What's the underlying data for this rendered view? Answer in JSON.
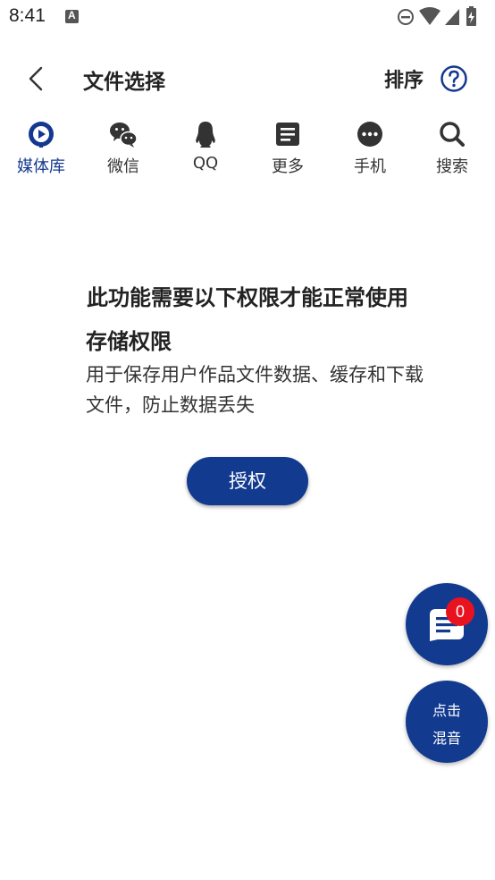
{
  "status": {
    "time": "8:41",
    "notification_icon": "a-icon"
  },
  "header": {
    "title": "文件选择",
    "sort_label": "排序",
    "help_icon": "help-circle-icon",
    "back_icon": "chevron-left-icon"
  },
  "tabs": [
    {
      "label": "媒体库",
      "icon": "media-library-icon",
      "active": true
    },
    {
      "label": "微信",
      "icon": "wechat-icon",
      "active": false
    },
    {
      "label": "QQ",
      "icon": "qq-icon",
      "active": false
    },
    {
      "label": "更多",
      "icon": "document-icon",
      "active": false
    },
    {
      "label": "手机",
      "icon": "more-dots-icon",
      "active": false
    },
    {
      "label": "搜索",
      "icon": "search-icon",
      "active": false
    }
  ],
  "permission": {
    "title": "此功能需要以下权限才能正常使用",
    "name": "存储权限",
    "description": "用于保存用户作品文件数据、缓存和下载文件，防止数据丢失",
    "button_label": "授权"
  },
  "fab": {
    "badge_count": "0",
    "mix_line1": "点击",
    "mix_line2": "混音"
  },
  "colors": {
    "accent": "#123a8f",
    "active_tab": "#14388f",
    "badge": "#e8131f"
  }
}
